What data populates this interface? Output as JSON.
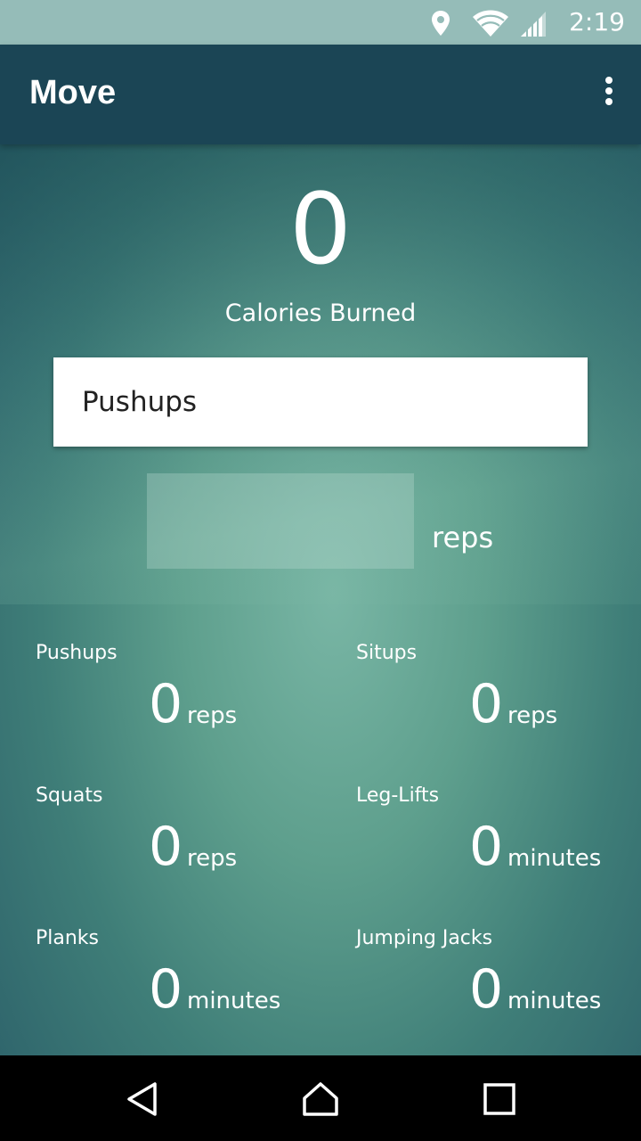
{
  "status_bar": {
    "time": "2:19",
    "icons": [
      "location-icon",
      "wifi-icon",
      "cell-signal-icon"
    ]
  },
  "app_bar": {
    "title": "Move",
    "menu_icon": "more-vert-icon"
  },
  "summary": {
    "calories_value": "0",
    "calories_label": "Calories Burned"
  },
  "exercise_form": {
    "selected_exercise": "Pushups",
    "amount_value": "",
    "unit": "reps"
  },
  "stats": [
    {
      "label": "Pushups",
      "value": "0",
      "unit": "reps"
    },
    {
      "label": "Situps",
      "value": "0",
      "unit": "reps"
    },
    {
      "label": "Squats",
      "value": "0",
      "unit": "reps"
    },
    {
      "label": "Leg-Lifts",
      "value": "0",
      "unit": "minutes"
    },
    {
      "label": "Planks",
      "value": "0",
      "unit": "minutes"
    },
    {
      "label": "Jumping Jacks",
      "value": "0",
      "unit": "minutes"
    }
  ],
  "nav_bar": {
    "icons": [
      "back-icon",
      "home-icon",
      "recents-icon"
    ]
  },
  "colors": {
    "status_bar": "#95bcb8",
    "app_bar": "#1b4555",
    "nav_bar": "#000000",
    "select_background": "#ffffff"
  }
}
